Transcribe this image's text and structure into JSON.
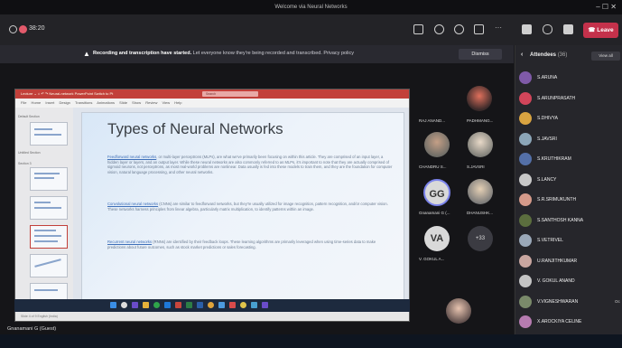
{
  "window": {
    "title": "Welcome via Neural Networks",
    "controls": "–  ☐  ✕"
  },
  "toolbar": {
    "timer": "38:20",
    "leave_label": "Leave"
  },
  "banner": {
    "bold_text": "Recording and transcription have started.",
    "rest_text": "Let everyone know they're being recorded and transcribed. Privacy policy",
    "dismiss_label": "Dismiss"
  },
  "ppt": {
    "ribbon_title": "Lecture ⌄  ⌂    ↶  ↷    Neural-network  PowerPoint    Switch to Pt",
    "search_placeholder": "Search",
    "menu": "File  Home  Insert  Design  Transitions  Animations  Slide Show  Review  View  Help",
    "section_labels": [
      "Default Section",
      "Untitled Section",
      "Section 3"
    ],
    "status": "Slide 4 of 9    English (India)",
    "slide": {
      "title": "Types of Neural Networks",
      "paragraphs": [
        {
          "term": "Feedforward neural networks",
          "text": ", or multi-layer perceptrons (MLPs), are what we've primarily been focusing on within this article. They are comprised of an input layer, a hidden layer or layers, and an output layer. While these neural networks are also commonly referred to as MLPs, it's important to note that they are actually comprised of sigmoid neurons, not perceptrons, as most real-world problems are nonlinear. Data usually is fed into these models to train them, and they are the foundation for computer vision, natural language processing, and other neural networks."
        },
        {
          "term": "Convolutional neural networks",
          "text": " (CNNs) are similar to feedforward networks, but they're usually utilized for image recognition, pattern recognition, and/or computer vision. These networks harness principles from linear algebra, particularly matrix multiplication, to identify patterns within an image."
        },
        {
          "term": "Recurrent neural networks",
          "text": " (RNNs) are identified by their feedback loops. These learning algorithms are primarily leveraged when using time-series data to make predictions about future outcomes, such as stock market predictions or sales forecasting."
        }
      ]
    }
  },
  "self_name": "Gnanamani G (Guest)",
  "tiles": [
    {
      "name": "RAJ ANAND...",
      "initials": ""
    },
    {
      "name": "PADHMANG...",
      "initials": ""
    },
    {
      "name": "CHANDRU S...",
      "initials": ""
    },
    {
      "name": "S.JAVSRI",
      "initials": ""
    },
    {
      "name": "Gnanamani G (...",
      "initials": "GG"
    },
    {
      "name": "DHANUSHK...",
      "initials": ""
    },
    {
      "name": "V. GOKUL A...",
      "initials": "VA"
    },
    {
      "name": "",
      "initials": "+33"
    }
  ],
  "attendees": {
    "title": "Attendees",
    "count": "(36)",
    "view_all": "View all",
    "list": [
      {
        "name": "S.ARUNA",
        "color": "#7f5aa8"
      },
      {
        "name": "S.ARUNPRASATH",
        "color": "#d2455a"
      },
      {
        "name": "S.DHIVYA",
        "color": "#d9a441"
      },
      {
        "name": "S.JAVSRI",
        "color": "#8ca6b8"
      },
      {
        "name": "S.KRUTHIKRAM",
        "color": "#5470a8"
      },
      {
        "name": "S.LANCY",
        "color": "#c8c8c8"
      },
      {
        "name": "S.R.SRIMUKUNTH",
        "color": "#d59a8a"
      },
      {
        "name": "S.SANTHOSH KANNA",
        "color": "#5b6e3e"
      },
      {
        "name": "S.VETRIVEL",
        "color": "#9aa8b8"
      },
      {
        "name": "U.RANJITHKUMAR",
        "color": "#c9a6a0"
      },
      {
        "name": "V. GOKUL ANAND",
        "color": "#c3c3c3"
      },
      {
        "name": "V.VIGNESHWARAN",
        "color": "#7a8a6a"
      },
      {
        "name": "X.AROCKIYA CELINE",
        "color": "#b67bb0"
      }
    ],
    "overflow_label": "Oc"
  }
}
